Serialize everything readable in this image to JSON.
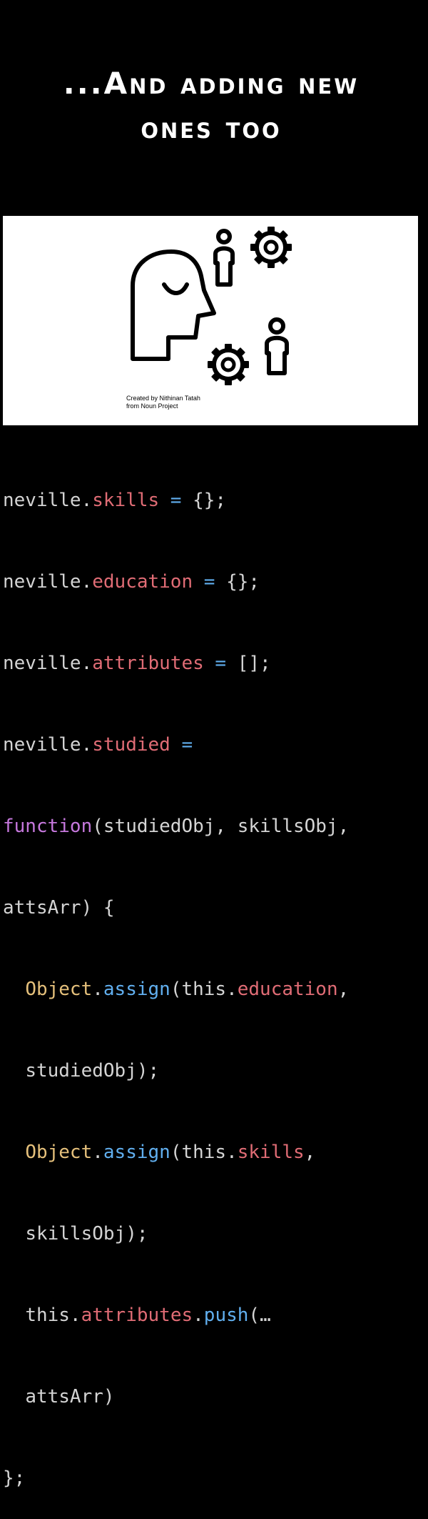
{
  "title": {
    "line1": "...And adding new",
    "line2": "ones too"
  },
  "illustration": {
    "credit_line1": "Created by Nithinan Tatah",
    "credit_line2": "from Noun Project",
    "icons": [
      "head-profile-icon",
      "person-icon",
      "gear-icon",
      "gear-icon",
      "person-icon"
    ]
  },
  "code": {
    "l1": {
      "a": "neville.",
      "b": "skills",
      "c": " = ",
      "d": "{};"
    },
    "l2": {
      "a": "neville.",
      "b": "education",
      "c": " = ",
      "d": "{};"
    },
    "l3": {
      "a": "neville.",
      "b": "attributes",
      "c": " = ",
      "d": "[];"
    },
    "l4": {
      "a": "neville.",
      "b": "studied",
      "c": " ="
    },
    "l5": {
      "a": "function",
      "b": "(studiedObj, skillsObj,"
    },
    "l6": {
      "a": "attsArr) {"
    },
    "l7": {
      "indent": "  ",
      "a": "Object",
      "b": ".",
      "c": "assign",
      "d": "(this.",
      "e": "education",
      "f": ","
    },
    "l8": {
      "indent": "  ",
      "a": "studiedObj);"
    },
    "l9": {
      "indent": "  ",
      "a": "Object",
      "b": ".",
      "c": "assign",
      "d": "(this.",
      "e": "skills",
      "f": ","
    },
    "l10": {
      "indent": "  ",
      "a": "skillsObj);"
    },
    "l11": {
      "indent": "  ",
      "a": "this.",
      "b": "attributes",
      "c": ".",
      "d": "push",
      "e": "(…"
    },
    "l12": {
      "indent": "  ",
      "a": "attsArr)"
    },
    "l13": {
      "a": "};"
    }
  },
  "colors": {
    "background": "#000000",
    "plain": "#d4d4d4",
    "property": "#e06c75",
    "operator": "#61afef",
    "keyword": "#c678dd",
    "class": "#e5c07b"
  }
}
